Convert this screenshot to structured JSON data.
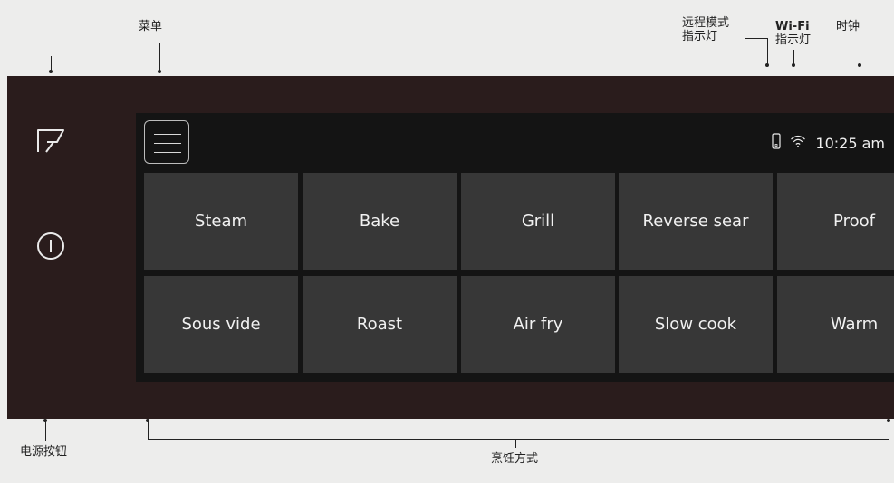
{
  "annotations": {
    "menu": "菜单",
    "remote_mode_line1": "远程模式",
    "remote_mode_line2": "指示灯",
    "wifi_line1": "Wi-Fi",
    "wifi_line2": "指示灯",
    "clock": "时钟",
    "power_button": "电源按钮",
    "cooking_modes": "烹饪方式"
  },
  "side_panel": {
    "icons": [
      "remote-control-icon",
      "power-icon"
    ]
  },
  "screen": {
    "menu_icon": "hamburger-menu-icon",
    "status": {
      "remote_icon": "phone-icon",
      "wifi_icon": "wifi-icon",
      "time": "10:25 am"
    },
    "modes_row1": [
      "Steam",
      "Bake",
      "Grill",
      "Reverse sear",
      "Proof"
    ],
    "modes_row2": [
      "Sous vide",
      "Roast",
      "Air fry",
      "Slow cook",
      "Warm"
    ]
  },
  "colors": {
    "page_background": "#ededec",
    "panel": "#2a1c1c",
    "screen": "#141414",
    "tile": "#373737",
    "text": "#f1f1f1"
  }
}
